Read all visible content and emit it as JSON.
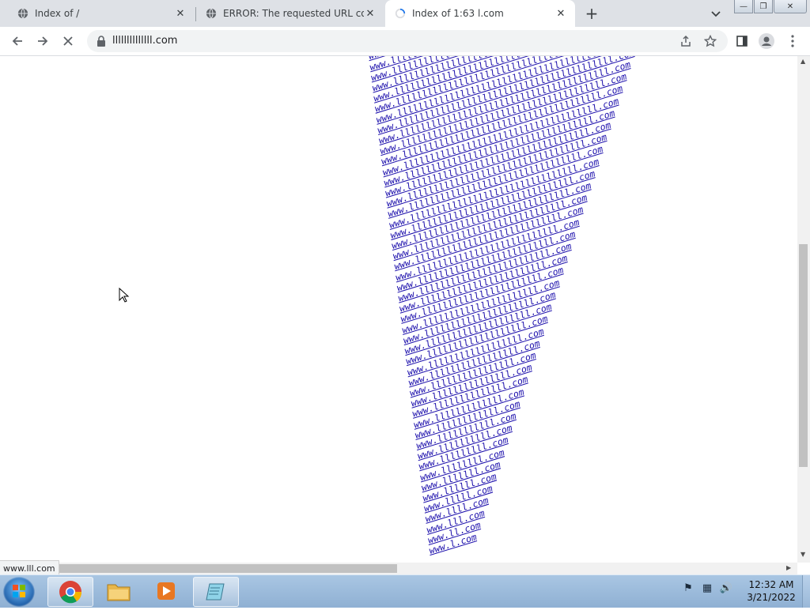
{
  "tabs": [
    {
      "title": "Index of /",
      "active": false
    },
    {
      "title": "ERROR: The requested URL could",
      "active": false
    },
    {
      "title": "Index of 1:63 l.com",
      "active": true
    }
  ],
  "toolbar": {
    "url": "llllllllllllll.com"
  },
  "content": {
    "links": [
      "www.llllllllllllllllllllllllllllllllllllllllllllllllll.com",
      "www.lllllllllllllllllllllllllllllllllllllllllllllllll.com",
      "www.llllllllllllllllllllllllllllllllllllllllllllllll.com",
      "www.lllllllllllllllllllllllllllllllllllllllllllllll.com",
      "www.llllllllllllllllllllllllllllllllllllllllllllll.com",
      "www.lllllllllllllllllllllllllllllllllllllllllllll.com",
      "www.llllllllllllllllllllllllllllllllllllllllllll.com",
      "www.lllllllllllllllllllllllllllllllllllllllllll.com",
      "www.llllllllllllllllllllllllllllllllllllllllll.com",
      "www.lllllllllllllllllllllllllllllllllllllllll.com",
      "www.llllllllllllllllllllllllllllllllllllllll.com",
      "www.lllllllllllllllllllllllllllllllllllllll.com",
      "www.llllllllllllllllllllllllllllllllllllll.com",
      "www.lllllllllllllllllllllllllllllllllllll.com",
      "www.llllllllllllllllllllllllllllllllllll.com",
      "www.lllllllllllllllllllllllllllllllllll.com",
      "www.llllllllllllllllllllllllllllllllll.com",
      "www.lllllllllllllllllllllllllllllllll.com",
      "www.llllllllllllllllllllllllllllllll.com",
      "www.lllllllllllllllllllllllllllllll.com",
      "www.llllllllllllllllllllllllllllll.com",
      "www.lllllllllllllllllllllllllllll.com",
      "www.llllllllllllllllllllllllllll.com",
      "www.lllllllllllllllllllllllllll.com",
      "www.llllllllllllllllllllllllll.com",
      "www.lllllllllllllllllllllllll.com",
      "www.llllllllllllllllllllllll.com",
      "www.lllllllllllllllllllllll.com",
      "www.llllllllllllllllllllll.com",
      "www.lllllllllllllllllllll.com",
      "www.llllllllllllllllllll.com",
      "www.lllllllllllllllllll.com",
      "www.llllllllllllllllll.com",
      "www.lllllllllllllllll.com",
      "www.llllllllllllllll.com",
      "www.lllllllllllllll.com",
      "www.llllllllllllll.com",
      "www.lllllllllllll.com",
      "www.llllllllllll.com",
      "www.lllllllllll.com",
      "www.llllllllll.com",
      "www.lllllllll.com",
      "www.llllllll.com",
      "www.lllllll.com",
      "www.llllll.com",
      "www.lllll.com",
      "www.llll.com",
      "www.lll.com",
      "www.ll.com",
      "www.l.com"
    ]
  },
  "status_bar": {
    "text": "www.lll.com"
  },
  "taskbar": {
    "items": [
      "chrome",
      "file-explorer",
      "media-player",
      "notepad"
    ],
    "clock": {
      "time": "12:32 AM",
      "date": "3/21/2022"
    }
  },
  "colors": {
    "link": "#1a0dab",
    "tabstrip": "#dee1e6",
    "taskbar": "#a9c6e3"
  }
}
